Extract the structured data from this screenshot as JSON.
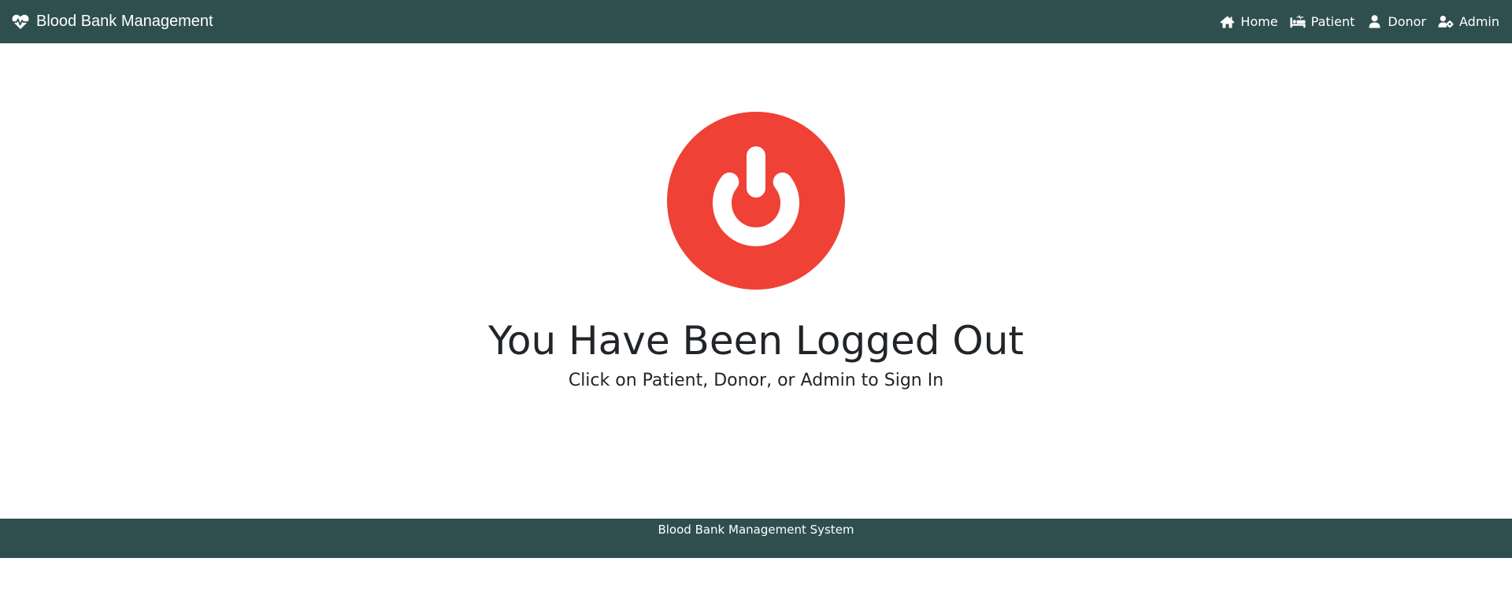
{
  "navbar": {
    "brand": {
      "label": "Blood Bank Management",
      "icon": "heartbeat-icon"
    },
    "links": [
      {
        "label": "Home",
        "icon": "home-icon"
      },
      {
        "label": "Patient",
        "icon": "procedures-bed-icon"
      },
      {
        "label": "Donor",
        "icon": "user-icon"
      },
      {
        "label": "Admin",
        "icon": "user-cog-icon"
      }
    ]
  },
  "main": {
    "icon": "power-icon",
    "headline": "You Have Been Logged Out",
    "subline": "Click on Patient, Donor, or Admin to Sign In"
  },
  "footer": {
    "text": "Blood Bank Management System"
  },
  "colors": {
    "navbar_bg": "#2f4f4f",
    "footer_bg": "#2f4f4f",
    "power_red": "#ef4136",
    "text_dark": "#212529",
    "text_light": "#ffffff"
  }
}
